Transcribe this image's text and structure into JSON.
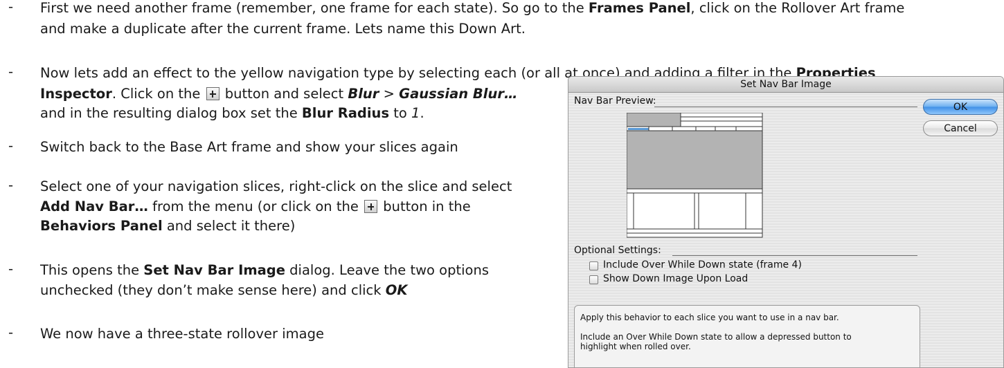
{
  "steps": [
    {
      "line1_a": "First we need another frame (remember, one frame for each state). So go to the ",
      "line1_b": "Frames Panel",
      "line1_c": ", click on the Rollover Art frame",
      "line2": "and make a duplicate after the current frame. Lets name this Down Art."
    },
    {
      "line1_a": "Now lets add an effect to the yellow navigation type by selecting each (or all at once) and adding a filter in the ",
      "line1_b": "Properties",
      "line2_a": "Inspector",
      "line2_b": ". Click on the ",
      "line2_c": " button and select ",
      "line2_d": "Blur",
      "line2_e": " > ",
      "line2_f": "Gaussian Blur…",
      "line3_a": "and in the resulting dialog box set the ",
      "line3_b": "Blur Radius",
      "line3_c": " to ",
      "line3_d": "1",
      "line3_e": "."
    },
    {
      "line1": "Switch back to the Base Art frame and show your slices again"
    },
    {
      "line1": "Select one of your navigation slices, right-click on the slice and select",
      "line2_a": "Add Nav Bar…",
      "line2_b": " from the menu (or click on the ",
      "line2_c": " button in the",
      "line3_a": "Behaviors Panel",
      "line3_b": " and select it there)"
    },
    {
      "line1_a": "This opens the ",
      "line1_b": "Set Nav Bar Image",
      "line1_c": " dialog. Leave the two options",
      "line2_a": "unchecked (they don’t make sense here) and click ",
      "line2_b": "OK"
    },
    {
      "line1": "We now have a three-state rollover image"
    }
  ],
  "dash": "-",
  "dialog": {
    "title": "Set Nav Bar Image",
    "preview_label": "Nav Bar Preview:",
    "ok_label": "OK",
    "cancel_label": "Cancel",
    "optional_label": "Optional Settings:",
    "checkbox1_label": "Include Over While Down state (frame 4)",
    "checkbox2_label": "Show Down Image Upon Load",
    "help_line1": "Apply this behavior to each slice you want to use in a nav bar.",
    "help_line2": "Include an Over While Down state to allow a depressed button to",
    "help_line3": "highlight when rolled over."
  }
}
